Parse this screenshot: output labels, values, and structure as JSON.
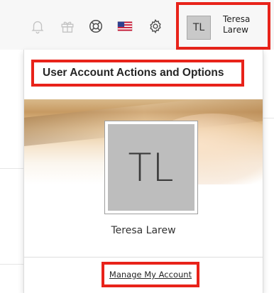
{
  "topbar": {
    "icons": [
      "bell-icon",
      "gift-icon",
      "help-icon",
      "flag-icon",
      "gear-icon"
    ],
    "user": {
      "initials": "TL",
      "first_name": "Teresa",
      "last_name": "Larew"
    }
  },
  "panel": {
    "title": "User Account Actions and Options",
    "avatar_initials": "TL",
    "full_name": "Teresa Larew",
    "manage_link": "Manage My Account"
  },
  "colors": {
    "highlight": "#e8231a",
    "avatar_bg": "#bdbdbd",
    "topbar_bg": "#f7f7f7"
  }
}
